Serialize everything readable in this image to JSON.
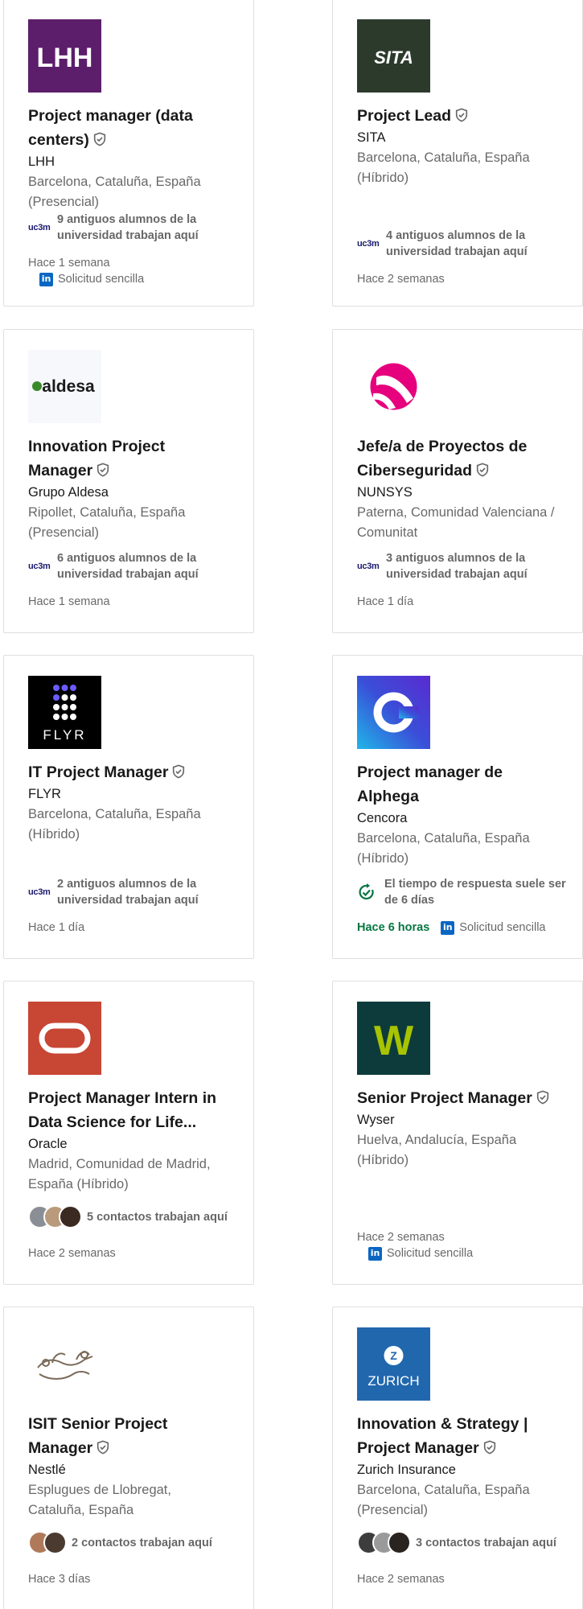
{
  "cards": [
    {
      "logo_text": "LHH",
      "title": "Project manager (data centers)",
      "company": "LHH",
      "location": "Barcelona, Cataluña, España (Presencial)",
      "insight": "9 antiguos alumnos de la universidad trabajan aquí",
      "insight_logo": "uc3m",
      "posted": "Hace 1 semana",
      "apply": "Solicitud sencilla"
    },
    {
      "logo_text": "SITA",
      "title": "Project Lead",
      "company": "SITA",
      "location": "Barcelona, Cataluña, España (Híbrido)",
      "insight": "4 antiguos alumnos de la universidad trabajan aquí",
      "insight_logo": "uc3m",
      "posted": "Hace 2 semanas"
    },
    {
      "logo_text": "aldesa",
      "title": "Innovation Project Manager",
      "company": "Grupo Aldesa",
      "location": "Ripollet, Cataluña, España (Presencial)",
      "insight": "6 antiguos alumnos de la universidad trabajan aquí",
      "insight_logo": "uc3m",
      "posted": "Hace 1 semana"
    },
    {
      "title": "Jefe/a de Proyectos de Ciberseguridad",
      "company": "NUNSYS",
      "location": "Paterna, Comunidad Valenciana / Comunitat",
      "insight": "3 antiguos alumnos de la universidad trabajan aquí",
      "insight_logo": "uc3m",
      "posted": "Hace 1 día"
    },
    {
      "logo_text": "FLYR",
      "title": "IT Project Manager",
      "company": "FLYR",
      "location": "Barcelona, Cataluña, España (Híbrido)",
      "insight": "2 antiguos alumnos de la universidad trabajan aquí",
      "insight_logo": "uc3m",
      "posted": "Hace 1 día"
    },
    {
      "title": "Project manager de Alphega",
      "company": "Cencora",
      "location": "Barcelona, Cataluña, España (Híbrido)",
      "insight": "El tiempo de respuesta suele ser de 6 días",
      "posted": "Hace 6 horas",
      "apply": "Solicitud sencilla"
    },
    {
      "title": "Project Manager Intern in Data Science for Life...",
      "company": "Oracle",
      "location": "Madrid, Comunidad de Madrid, España (Híbrido)",
      "insight": "5 contactos trabajan aquí",
      "posted": "Hace 2 semanas"
    },
    {
      "logo_text": "W",
      "title": "Senior Project Manager",
      "company": "Wyser",
      "location": "Huelva, Andalucía, España (Híbrido)",
      "posted": "Hace 2 semanas",
      "apply": "Solicitud sencilla"
    },
    {
      "title": "ISIT Senior Project Manager",
      "company": "Nestlé",
      "location": "Esplugues de Llobregat, Cataluña, España",
      "insight": "2 contactos trabajan aquí",
      "posted": "Hace 3 días"
    },
    {
      "logo_text": "ZURICH",
      "title": "Innovation & Strategy | Project Manager",
      "company": "Zurich Insurance",
      "location": "Barcelona, Cataluña, España (Presencial)",
      "insight": "3 contactos trabajan aquí",
      "posted": "Hace 2 semanas"
    }
  ],
  "colors": {
    "accent": "#0a66c2",
    "green": "#057642",
    "border": "#e0dfdc"
  },
  "li_glyph": "in"
}
